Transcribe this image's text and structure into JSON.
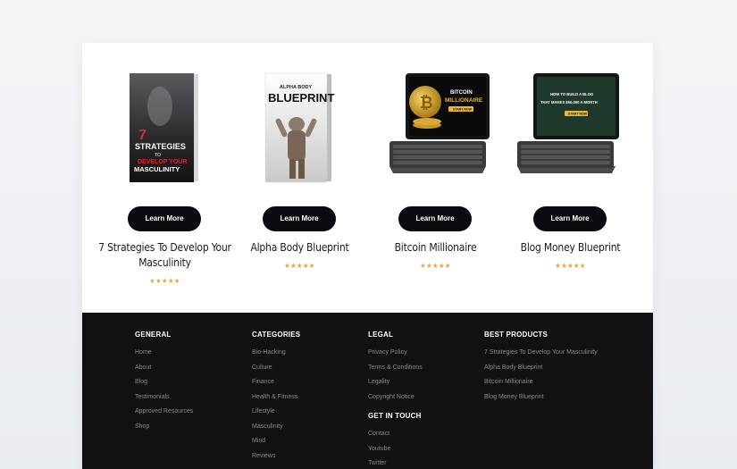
{
  "products": [
    {
      "title": "7 Strategies To Develop Your Masculinity",
      "button": "Learn More",
      "stars": "★★★★★",
      "image_text": [
        "7",
        "STRATEGIES",
        "TO",
        "DEVELOP YOUR",
        "MASCULINITY"
      ]
    },
    {
      "title": "Alpha Body Blueprint",
      "button": "Learn More",
      "stars": "★★★★★",
      "image_text": [
        "ALPHA BODY",
        "BLUEPRINT"
      ]
    },
    {
      "title": "Bitcoin Millionaire",
      "button": "Learn More",
      "stars": "★★★★★",
      "image_text": [
        "BITCOIN",
        "MILLIONAIRE",
        "START NOW"
      ]
    },
    {
      "title": "Blog Money Blueprint",
      "button": "Learn More",
      "stars": "★★★★★",
      "image_text": [
        "HOW TO BUILD A BLOG",
        "THAT MAKES $50,000 A MONTH",
        "START NOW"
      ]
    }
  ],
  "footer": {
    "general": {
      "heading": "GENERAL",
      "links": [
        "Home",
        "About",
        "Blog",
        "Testimonials",
        "Approved Resources",
        "Shop"
      ]
    },
    "categories": {
      "heading": "CATEGORIES",
      "links": [
        "Bio-Hacking",
        "Culture",
        "Finance",
        "Health & Fitness",
        "Lifestyle",
        "Masculinity",
        "Mind",
        "Reviews"
      ]
    },
    "legal": {
      "heading": "LEGAL",
      "links": [
        "Privacy Policy",
        "Terms & Conditions",
        "Legality",
        "Copyright Notice"
      ]
    },
    "get_in_touch": {
      "heading": "GET IN TOUCH",
      "links": [
        "Contact",
        "Youtube",
        "Twitter"
      ]
    },
    "best_products": {
      "heading": "BEST PRODUCTS",
      "links": [
        "7 Strategies To Develop Your Masculinity",
        "Alpha Body Blueprint",
        "Bitcoin Millionaire",
        "Blog Money Blueprint"
      ]
    }
  },
  "colors": {
    "footer_bg": "#111113",
    "button_bg": "#0b0b0f",
    "star": "#e9a23b",
    "accent_red": "#d62b2b",
    "gold": "#d4a536",
    "green_screen": "#1f3a2c"
  }
}
